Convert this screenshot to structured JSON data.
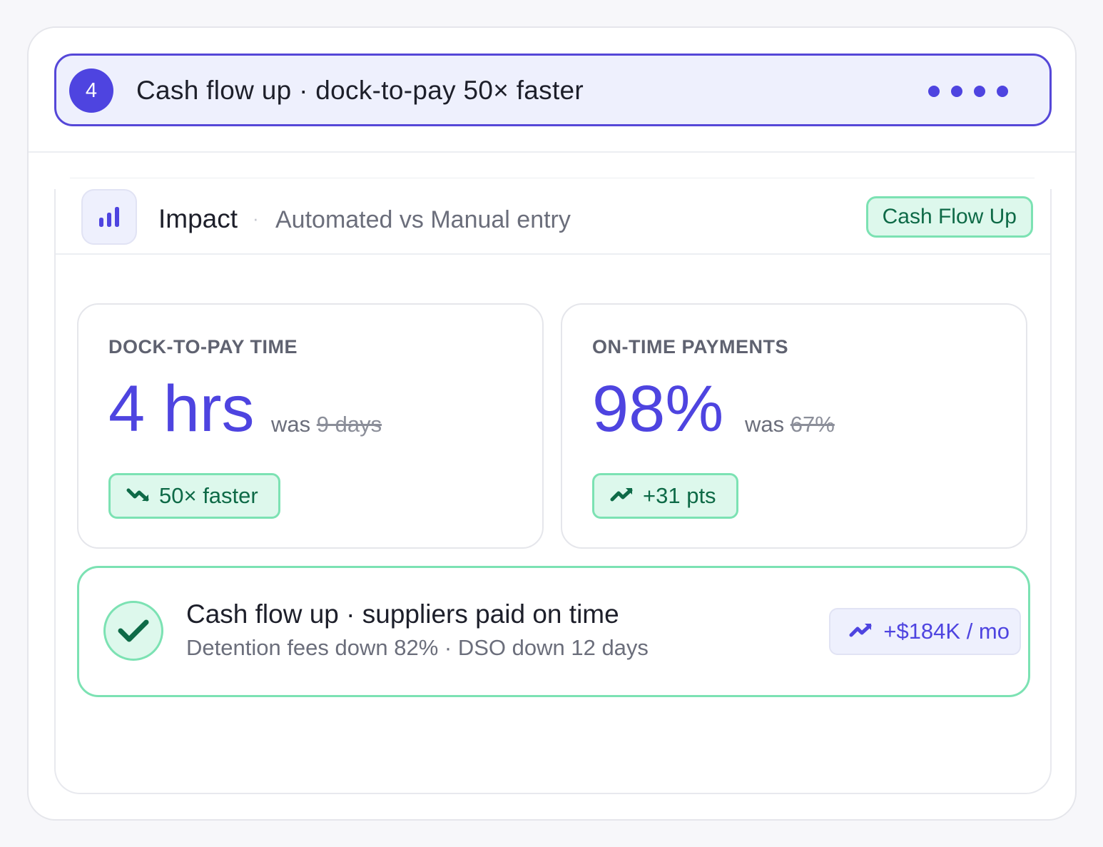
{
  "step": {
    "number": "4",
    "title": "Cash flow up · dock-to-pay 50× faster"
  },
  "impact": {
    "title": "Impact",
    "separator": "·",
    "subtitle": "Automated vs Manual entry",
    "tag": "Cash Flow Up"
  },
  "metrics": [
    {
      "label": "DOCK-TO-PAY TIME",
      "value": "4 hrs",
      "was_prefix": "was",
      "was_value": "9 days",
      "pill": "50× faster",
      "pill_icon": "trend-down-icon"
    },
    {
      "label": "ON-TIME PAYMENTS",
      "value": "98%",
      "was_prefix": "was",
      "was_value": "67%",
      "pill": "+31 pts",
      "pill_icon": "trend-up-icon"
    }
  ],
  "summary": {
    "title": "Cash flow up · suppliers paid on time",
    "subtitle": "Detention fees down 82% · DSO down 12 days",
    "gain": "+$184K / mo",
    "gain_icon": "trend-up-icon"
  },
  "colors": {
    "accent": "#4e44e0",
    "success": "#0e6a47",
    "success_bg": "#ddf8ec",
    "success_border": "#7ce2b3"
  }
}
